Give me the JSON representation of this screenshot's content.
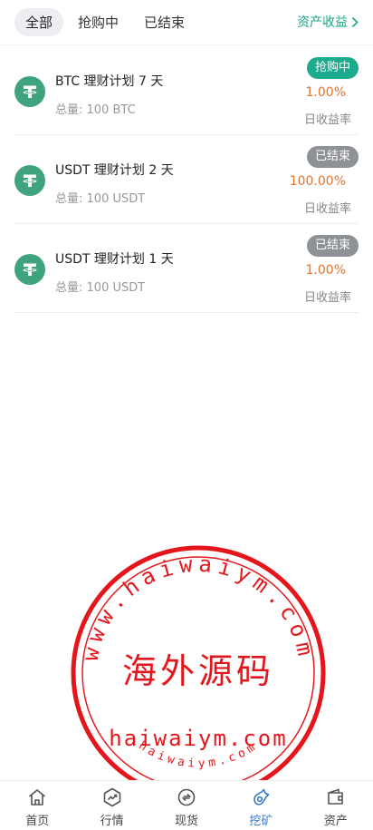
{
  "tabs": [
    {
      "label": "全部",
      "active": true
    },
    {
      "label": "抢购中",
      "active": false
    },
    {
      "label": "已结束",
      "active": false
    }
  ],
  "assets_link": {
    "label": "资产收益",
    "icon": "chevron-right-icon"
  },
  "items": [
    {
      "coin_icon": "tether-icon",
      "title": "BTC  理财计划 7 天",
      "total_label": "总量:",
      "total_value": "100 BTC",
      "status": "抢购中",
      "status_color": "#1bac8d",
      "rate": "1.00%",
      "rate_label": "日收益率"
    },
    {
      "coin_icon": "tether-icon",
      "title": "USDT  理财计划 2 天",
      "total_label": "总量:",
      "total_value": "100 USDT",
      "status": "已结束",
      "status_color": "#8e9196",
      "rate": "100.00%",
      "rate_label": "日收益率"
    },
    {
      "coin_icon": "tether-icon",
      "title": "USDT  理财计划 1 天",
      "total_label": "总量:",
      "total_value": "100 USDT",
      "status": "已结束",
      "status_color": "#8e9196",
      "rate": "1.00%",
      "rate_label": "日收益率"
    }
  ],
  "watermark": {
    "top_text": "www.haiwaiym.com",
    "main_text": "海外源码",
    "domain_text": "haiwaiym.com",
    "bottom_text": "haiwaiym.com",
    "color": "#e5161b"
  },
  "bottom_nav": [
    {
      "label": "首页",
      "icon": "home-icon",
      "active": false
    },
    {
      "label": "行情",
      "icon": "market-icon",
      "active": false
    },
    {
      "label": "现货",
      "icon": "spot-icon",
      "active": false
    },
    {
      "label": "挖矿",
      "icon": "mining-icon",
      "active": true
    },
    {
      "label": "资产",
      "icon": "wallet-icon",
      "active": false
    }
  ],
  "colors": {
    "accent": "#1aa58a",
    "rate": "#e0742e",
    "nav_active": "#3a78c8",
    "coin": "#3fa37e"
  }
}
